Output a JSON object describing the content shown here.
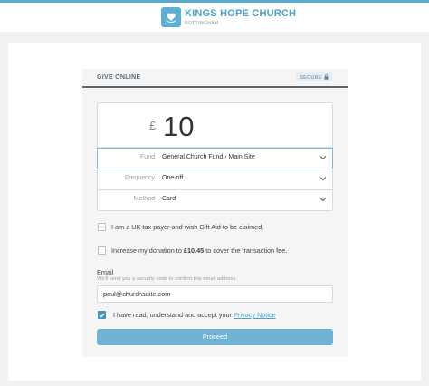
{
  "header": {
    "church_name": "KINGS HOPE CHURCH",
    "location": "NOTTINGHAM",
    "logo_icon": "heart-in-hand-icon",
    "accent_color": "#5aaccf"
  },
  "give": {
    "title": "GIVE ONLINE",
    "secure_label": "SECURE",
    "secure_icon": "lock-icon",
    "currency_symbol": "£",
    "amount": "10"
  },
  "fields": {
    "fund": {
      "label": "Fund",
      "value": "General Church Fund › Main Site"
    },
    "frequency": {
      "label": "Frequency",
      "value": "One-off"
    },
    "method": {
      "label": "Method",
      "value": "Card"
    }
  },
  "options": {
    "gift_aid": {
      "text": "I am a UK tax payer and wish Gift Aid to be claimed.",
      "checked": false
    },
    "fee": {
      "text_before": "Increase my donation to ",
      "amount": "£10.45",
      "text_after": " to cover the transaction fee.",
      "checked": false
    },
    "terms": {
      "text": "I have read, understand and accept your ",
      "link": "Privacy Notice",
      "checked": true
    }
  },
  "email": {
    "label": "Email",
    "help": "We'll send you a security code to confirm this email address.",
    "value": "paul@churchsuite.com"
  },
  "proceed_label": "Proceed"
}
